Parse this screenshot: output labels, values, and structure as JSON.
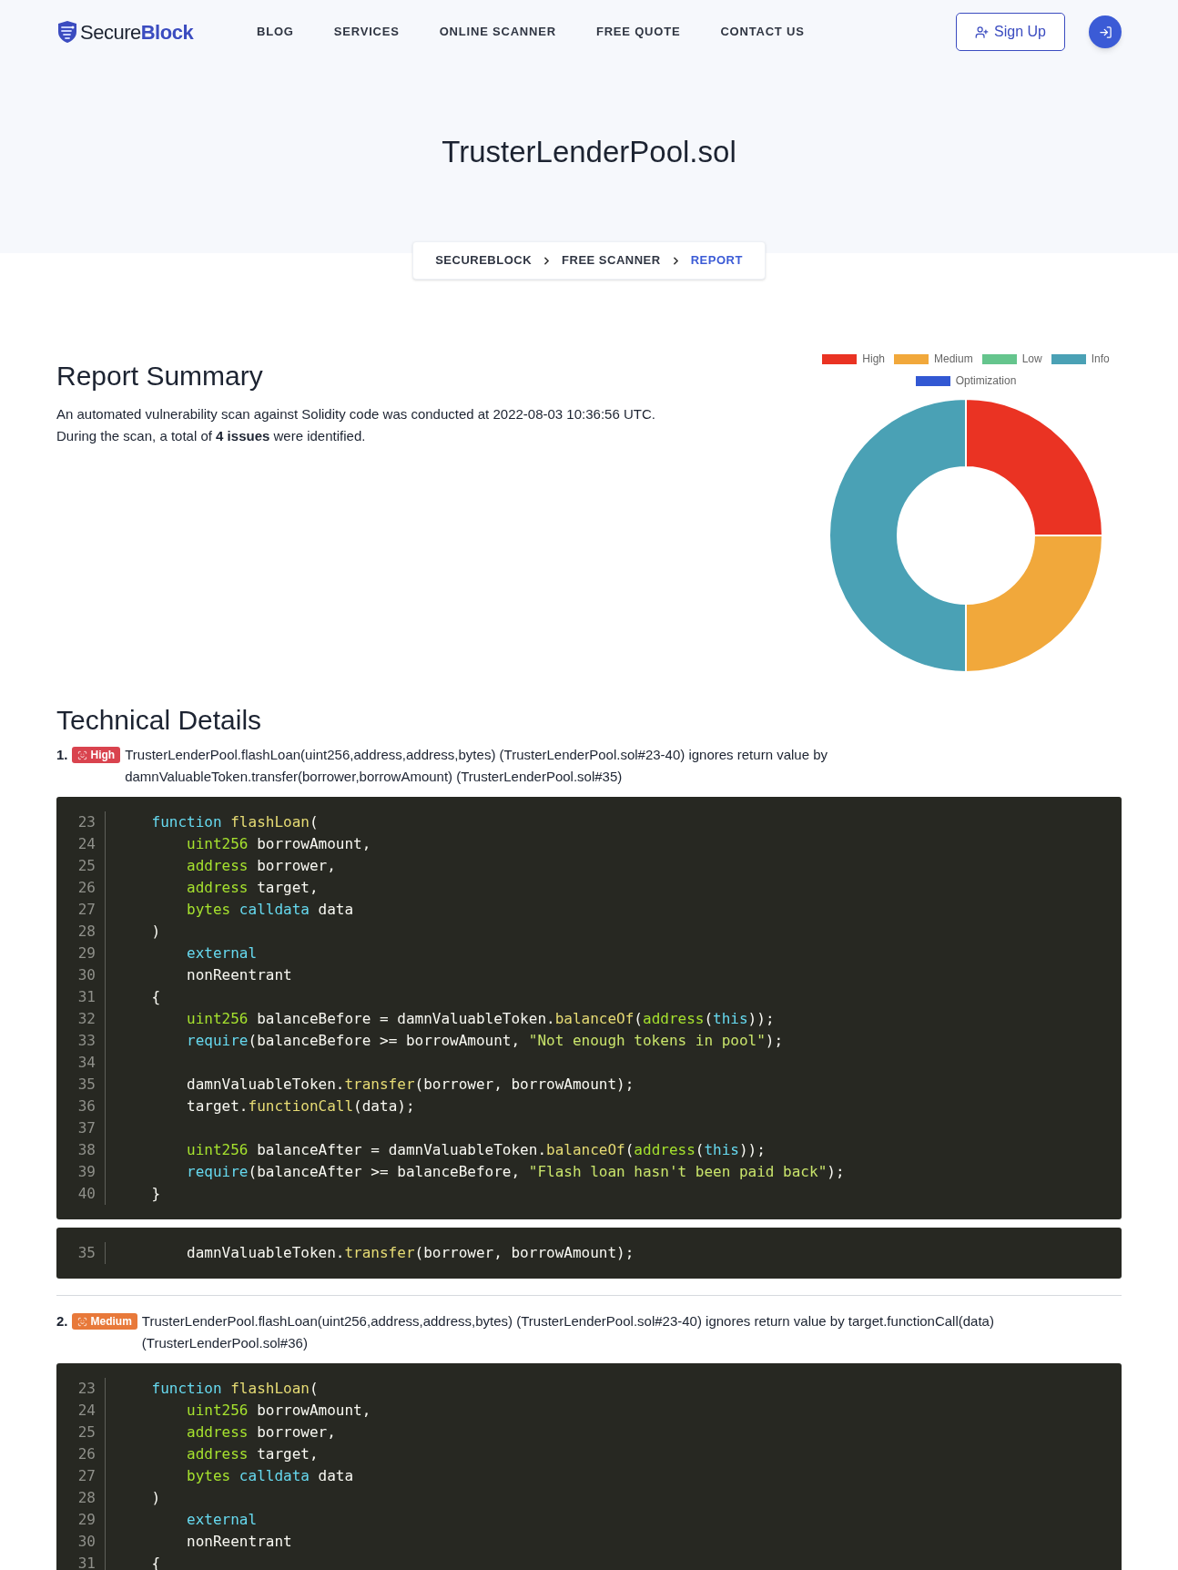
{
  "header": {
    "logo": {
      "text": "Secure",
      "accent": "Block"
    },
    "nav": [
      {
        "label": "BLOG"
      },
      {
        "label": "SERVICES"
      },
      {
        "label": "ONLINE SCANNER"
      },
      {
        "label": "FREE QUOTE"
      },
      {
        "label": "CONTACT US"
      }
    ],
    "signup": "Sign Up"
  },
  "hero": {
    "title": "TrusterLenderPool.sol"
  },
  "breadcrumb": [
    {
      "label": "SECUREBLOCK",
      "selected": false
    },
    {
      "label": "FREE SCANNER",
      "selected": false
    },
    {
      "label": "REPORT",
      "selected": true
    }
  ],
  "summary": {
    "title": "Report Summary",
    "lines": [
      "An automated vulnerability scan against Solidity code was conducted at 2022-08-03 10:36:56 UTC.",
      "During the scan, a total of **4 issues** were identified."
    ]
  },
  "chart_data": {
    "type": "donut",
    "legend": "top",
    "categories": [
      "High",
      "Medium",
      "Low",
      "Info",
      "Optimization"
    ],
    "values": [
      25,
      25,
      0,
      50,
      0
    ],
    "colors": [
      "#ea3323",
      "#f1a83b",
      "#65c58d",
      "#4aa1b5",
      "#3258d3"
    ]
  },
  "details": {
    "title": "Technical Details",
    "issues": [
      {
        "number": "1.",
        "severity": {
          "kind": "high",
          "label": "High"
        },
        "text": "TrusterLenderPool.flashLoan(uint256,address,address,bytes) (TrusterLenderPool.sol#23-40) ignores return value by damnValuableToken.transfer(borrower,borrowAmount) (TrusterLenderPool.sol#35)",
        "blocks": [
          {
            "lines": [
              {
                "number": "23",
                "tokens": [
                  {
                    "kind": "keyword",
                    "text": "    function "
                  },
                  {
                    "kind": "func",
                    "text": "flashLoan"
                  },
                  {
                    "kind": "plain",
                    "text": "("
                  }
                ]
              },
              {
                "number": "24",
                "tokens": [
                  {
                    "kind": "type",
                    "text": "        uint256"
                  },
                  {
                    "kind": "plain",
                    "text": " borrowAmount,"
                  }
                ]
              },
              {
                "number": "25",
                "tokens": [
                  {
                    "kind": "type",
                    "text": "        address"
                  },
                  {
                    "kind": "plain",
                    "text": " borrower,"
                  }
                ]
              },
              {
                "number": "26",
                "tokens": [
                  {
                    "kind": "type",
                    "text": "        address"
                  },
                  {
                    "kind": "plain",
                    "text": " target,"
                  }
                ]
              },
              {
                "number": "27",
                "tokens": [
                  {
                    "kind": "type",
                    "text": "        bytes"
                  },
                  {
                    "kind": "keyword",
                    "text": " calldata"
                  },
                  {
                    "kind": "plain",
                    "text": " data"
                  }
                ]
              },
              {
                "number": "28",
                "tokens": [
                  {
                    "kind": "plain",
                    "text": "    )"
                  }
                ]
              },
              {
                "number": "29",
                "tokens": [
                  {
                    "kind": "keyword",
                    "text": "        external"
                  }
                ]
              },
              {
                "number": "30",
                "tokens": [
                  {
                    "kind": "plain",
                    "text": "        nonReentrant"
                  }
                ]
              },
              {
                "number": "31",
                "tokens": [
                  {
                    "kind": "plain",
                    "text": "    {"
                  }
                ]
              },
              {
                "number": "32",
                "tokens": [
                  {
                    "kind": "type",
                    "text": "        uint256"
                  },
                  {
                    "kind": "plain",
                    "text": " balanceBefore = damnValuableToken."
                  },
                  {
                    "kind": "func",
                    "text": "balanceOf"
                  },
                  {
                    "kind": "plain",
                    "text": "("
                  },
                  {
                    "kind": "type",
                    "text": "address"
                  },
                  {
                    "kind": "plain",
                    "text": "("
                  },
                  {
                    "kind": "keyword",
                    "text": "this"
                  },
                  {
                    "kind": "plain",
                    "text": "));"
                  }
                ]
              },
              {
                "number": "33",
                "tokens": [
                  {
                    "kind": "keyword",
                    "text": "        require"
                  },
                  {
                    "kind": "plain",
                    "text": "(balanceBefore >= borrowAmount, "
                  },
                  {
                    "kind": "string",
                    "text": "\"Not enough tokens in pool\""
                  },
                  {
                    "kind": "plain",
                    "text": ");"
                  }
                ]
              },
              {
                "number": "34"
              },
              {
                "number": "35",
                "tokens": [
                  {
                    "kind": "plain",
                    "text": "        damnValuableToken."
                  },
                  {
                    "kind": "func",
                    "text": "transfer"
                  },
                  {
                    "kind": "plain",
                    "text": "(borrower, borrowAmount);"
                  }
                ]
              },
              {
                "number": "36",
                "tokens": [
                  {
                    "kind": "plain",
                    "text": "        target."
                  },
                  {
                    "kind": "func",
                    "text": "functionCall"
                  },
                  {
                    "kind": "plain",
                    "text": "(data);"
                  }
                ]
              },
              {
                "number": "37"
              },
              {
                "number": "38",
                "tokens": [
                  {
                    "kind": "type",
                    "text": "        uint256"
                  },
                  {
                    "kind": "plain",
                    "text": " balanceAfter = damnValuableToken."
                  },
                  {
                    "kind": "func",
                    "text": "balanceOf"
                  },
                  {
                    "kind": "plain",
                    "text": "("
                  },
                  {
                    "kind": "type",
                    "text": "address"
                  },
                  {
                    "kind": "plain",
                    "text": "("
                  },
                  {
                    "kind": "keyword",
                    "text": "this"
                  },
                  {
                    "kind": "plain",
                    "text": "));"
                  }
                ]
              },
              {
                "number": "39",
                "tokens": [
                  {
                    "kind": "keyword",
                    "text": "        require"
                  },
                  {
                    "kind": "plain",
                    "text": "(balanceAfter >= balanceBefore, "
                  },
                  {
                    "kind": "string",
                    "text": "\"Flash loan hasn't been paid back\""
                  },
                  {
                    "kind": "plain",
                    "text": ");"
                  }
                ]
              },
              {
                "number": "40",
                "tokens": [
                  {
                    "kind": "plain",
                    "text": "    }"
                  }
                ]
              }
            ]
          },
          {
            "lines": [
              {
                "number": "35",
                "tokens": [
                  {
                    "kind": "plain",
                    "text": "        damnValuableToken."
                  },
                  {
                    "kind": "func",
                    "text": "transfer"
                  },
                  {
                    "kind": "plain",
                    "text": "(borrower, borrowAmount);"
                  }
                ]
              }
            ]
          }
        ]
      },
      {
        "number": "2.",
        "severity": {
          "kind": "medium",
          "label": "Medium"
        },
        "text": "TrusterLenderPool.flashLoan(uint256,address,address,bytes) (TrusterLenderPool.sol#23-40) ignores return value by target.functionCall(data) (TrusterLenderPool.sol#36)",
        "blocks": [
          {
            "lines": [
              {
                "number": "23",
                "tokens": [
                  {
                    "kind": "keyword",
                    "text": "    function "
                  },
                  {
                    "kind": "func",
                    "text": "flashLoan"
                  },
                  {
                    "kind": "plain",
                    "text": "("
                  }
                ]
              },
              {
                "number": "24",
                "tokens": [
                  {
                    "kind": "type",
                    "text": "        uint256"
                  },
                  {
                    "kind": "plain",
                    "text": " borrowAmount,"
                  }
                ]
              },
              {
                "number": "25",
                "tokens": [
                  {
                    "kind": "type",
                    "text": "        address"
                  },
                  {
                    "kind": "plain",
                    "text": " borrower,"
                  }
                ]
              },
              {
                "number": "26",
                "tokens": [
                  {
                    "kind": "type",
                    "text": "        address"
                  },
                  {
                    "kind": "plain",
                    "text": " target,"
                  }
                ]
              },
              {
                "number": "27",
                "tokens": [
                  {
                    "kind": "type",
                    "text": "        bytes"
                  },
                  {
                    "kind": "keyword",
                    "text": " calldata"
                  },
                  {
                    "kind": "plain",
                    "text": " data"
                  }
                ]
              },
              {
                "number": "28",
                "tokens": [
                  {
                    "kind": "plain",
                    "text": "    )"
                  }
                ]
              },
              {
                "number": "29",
                "tokens": [
                  {
                    "kind": "keyword",
                    "text": "        external"
                  }
                ]
              },
              {
                "number": "30",
                "tokens": [
                  {
                    "kind": "plain",
                    "text": "        nonReentrant"
                  }
                ]
              },
              {
                "number": "31",
                "tokens": [
                  {
                    "kind": "plain",
                    "text": "    {"
                  }
                ]
              }
            ]
          }
        ]
      }
    ]
  }
}
